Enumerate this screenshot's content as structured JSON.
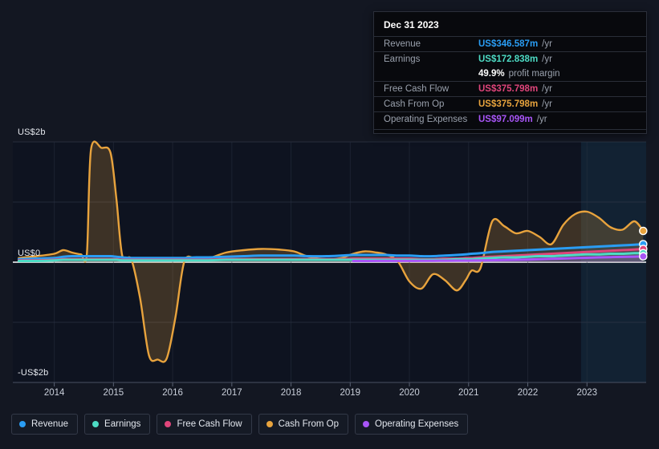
{
  "theme": {
    "page_bg": "#131722",
    "plot_bg": "#0e1320",
    "forecast_bg": "#0f2030",
    "grid": "#2c3murk",
    "zero_line": "#ffffff"
  },
  "tooltip": {
    "title": "Dec 31 2023",
    "rows": [
      {
        "key": "Revenue",
        "value": "US$346.587m",
        "unit": "/yr",
        "color": "#2a9df4"
      },
      {
        "key": "Earnings",
        "value": "US$172.838m",
        "unit": "/yr",
        "color": "#4ddbc4"
      },
      {
        "key": "Free Cash Flow",
        "value": "US$375.798m",
        "unit": "/yr",
        "color": "#e0457b"
      },
      {
        "key": "Cash From Op",
        "value": "US$375.798m",
        "unit": "/yr",
        "color": "#e8a33d"
      },
      {
        "key": "Operating Expenses",
        "value": "US$97.099m",
        "unit": "/yr",
        "color": "#a855f7"
      }
    ],
    "profit_margin": {
      "value": "49.9%",
      "label": "profit margin"
    }
  },
  "legend": {
    "items": [
      {
        "label": "Revenue",
        "color": "#2a9df4"
      },
      {
        "label": "Earnings",
        "color": "#4ddbc4"
      },
      {
        "label": "Free Cash Flow",
        "color": "#e0457b"
      },
      {
        "label": "Cash From Op",
        "color": "#e8a33d"
      },
      {
        "label": "Operating Expenses",
        "color": "#a855f7"
      }
    ]
  },
  "chart_data": {
    "type": "area",
    "title": "",
    "xlabel": "",
    "ylabel": "",
    "grid": true,
    "legend_position": "bottom",
    "unit": "US$",
    "ylim": [
      -2.0,
      2.0
    ],
    "ytick_labels": [
      "US$2b",
      "US$0",
      "-US$2b"
    ],
    "ytick_values": [
      2.0,
      0.0,
      -2.0
    ],
    "xlim": [
      2013.3,
      2024.0
    ],
    "xtick_labels": [
      "2014",
      "2015",
      "2016",
      "2017",
      "2018",
      "2019",
      "2020",
      "2021",
      "2022",
      "2023"
    ],
    "xtick_values": [
      2014,
      2015,
      2016,
      2017,
      2018,
      2019,
      2020,
      2021,
      2022,
      2023
    ],
    "forecast_region": {
      "from": 2022.9,
      "to": 2024.0,
      "label": ""
    },
    "x": [
      2013.4,
      2013.7,
      2014.0,
      2014.15,
      2014.3,
      2014.45,
      2014.55,
      2014.62,
      2014.8,
      2014.95,
      2015.05,
      2015.15,
      2015.3,
      2015.45,
      2015.6,
      2015.75,
      2015.9,
      2016.05,
      2016.2,
      2016.4,
      2016.6,
      2016.9,
      2017.2,
      2017.5,
      2017.8,
      2018.05,
      2018.3,
      2018.6,
      2018.85,
      2019.05,
      2019.25,
      2019.45,
      2019.6,
      2019.8,
      2020.0,
      2020.2,
      2020.4,
      2020.6,
      2020.8,
      2020.95,
      2021.05,
      2021.2,
      2021.4,
      2021.6,
      2021.8,
      2022.0,
      2022.2,
      2022.4,
      2022.6,
      2022.8,
      2023.0,
      2023.2,
      2023.4,
      2023.6,
      2023.8,
      2023.95
    ],
    "series": [
      {
        "name": "Cash From Op",
        "color": "#e8a33d",
        "fill": "rgba(232,163,61,0.22)",
        "values": [
          0.07,
          0.1,
          0.14,
          0.2,
          0.16,
          0.13,
          0.13,
          1.87,
          1.9,
          1.82,
          1.05,
          0.1,
          0.05,
          -0.6,
          -1.55,
          -1.62,
          -1.6,
          -0.9,
          0.02,
          0.05,
          0.06,
          0.16,
          0.2,
          0.22,
          0.21,
          0.18,
          0.09,
          0.05,
          0.07,
          0.14,
          0.18,
          0.16,
          0.13,
          0.02,
          -0.32,
          -0.44,
          -0.2,
          -0.3,
          -0.47,
          -0.3,
          -0.14,
          -0.1,
          0.68,
          0.6,
          0.48,
          0.52,
          0.42,
          0.3,
          0.62,
          0.8,
          0.84,
          0.74,
          0.58,
          0.54,
          0.68,
          0.52
        ]
      },
      {
        "name": "Revenue",
        "color": "#2a9df4",
        "fill": "rgba(42,157,244,0.10)",
        "values": [
          0.05,
          0.06,
          0.07,
          0.09,
          0.1,
          0.1,
          0.1,
          0.1,
          0.1,
          0.1,
          0.09,
          0.08,
          0.07,
          0.07,
          0.07,
          0.07,
          0.07,
          0.07,
          0.07,
          0.08,
          0.08,
          0.09,
          0.1,
          0.11,
          0.11,
          0.11,
          0.1,
          0.1,
          0.11,
          0.12,
          0.12,
          0.12,
          0.12,
          0.11,
          0.11,
          0.1,
          0.1,
          0.11,
          0.12,
          0.13,
          0.14,
          0.15,
          0.17,
          0.18,
          0.19,
          0.2,
          0.21,
          0.22,
          0.23,
          0.24,
          0.25,
          0.26,
          0.27,
          0.28,
          0.29,
          0.3
        ]
      },
      {
        "name": "Free Cash Flow",
        "color": "#e0457b",
        "fill": "rgba(224,69,123,0.12)",
        "values": [
          0.03,
          0.03,
          0.04,
          0.05,
          0.05,
          0.05,
          0.05,
          0.05,
          0.05,
          0.05,
          0.05,
          0.04,
          0.04,
          0.04,
          0.04,
          0.04,
          0.04,
          0.04,
          0.04,
          0.04,
          0.04,
          0.05,
          0.05,
          0.05,
          0.05,
          0.05,
          0.05,
          0.05,
          0.05,
          0.06,
          0.06,
          0.06,
          0.06,
          0.06,
          0.06,
          0.05,
          0.05,
          0.06,
          0.06,
          0.07,
          0.07,
          0.08,
          0.09,
          0.1,
          0.11,
          0.12,
          0.13,
          0.14,
          0.15,
          0.16,
          0.17,
          0.18,
          0.19,
          0.2,
          0.21,
          0.22
        ]
      },
      {
        "name": "Earnings",
        "color": "#4ddbc4",
        "fill": "rgba(77,219,196,0.14)",
        "values": [
          0.02,
          0.02,
          0.03,
          0.04,
          0.04,
          0.04,
          0.04,
          0.04,
          0.04,
          0.04,
          0.04,
          0.03,
          0.03,
          0.03,
          0.03,
          0.03,
          0.03,
          0.03,
          0.03,
          0.03,
          0.03,
          0.04,
          0.04,
          0.04,
          0.04,
          0.04,
          0.04,
          0.04,
          0.04,
          0.04,
          0.04,
          0.04,
          0.04,
          0.04,
          0.04,
          0.04,
          0.04,
          0.04,
          0.05,
          0.05,
          0.05,
          0.06,
          0.07,
          0.08,
          0.08,
          0.09,
          0.1,
          0.1,
          0.11,
          0.12,
          0.13,
          0.13,
          0.14,
          0.14,
          0.15,
          0.15
        ]
      },
      {
        "name": "Operating Expenses",
        "color": "#a855f7",
        "fill": "rgba(168,85,247,0.16)",
        "start_x": 2019.0,
        "values": [
          null,
          null,
          null,
          null,
          null,
          null,
          null,
          null,
          null,
          null,
          null,
          null,
          null,
          null,
          null,
          null,
          null,
          null,
          null,
          null,
          null,
          null,
          null,
          null,
          null,
          null,
          null,
          null,
          null,
          0.02,
          0.02,
          0.021,
          0.021,
          0.022,
          0.022,
          0.023,
          0.024,
          0.025,
          0.026,
          0.027,
          0.028,
          0.03,
          0.033,
          0.036,
          0.04,
          0.044,
          0.05,
          0.056,
          0.062,
          0.068,
          0.074,
          0.08,
          0.084,
          0.088,
          0.092,
          0.097
        ]
      }
    ]
  }
}
